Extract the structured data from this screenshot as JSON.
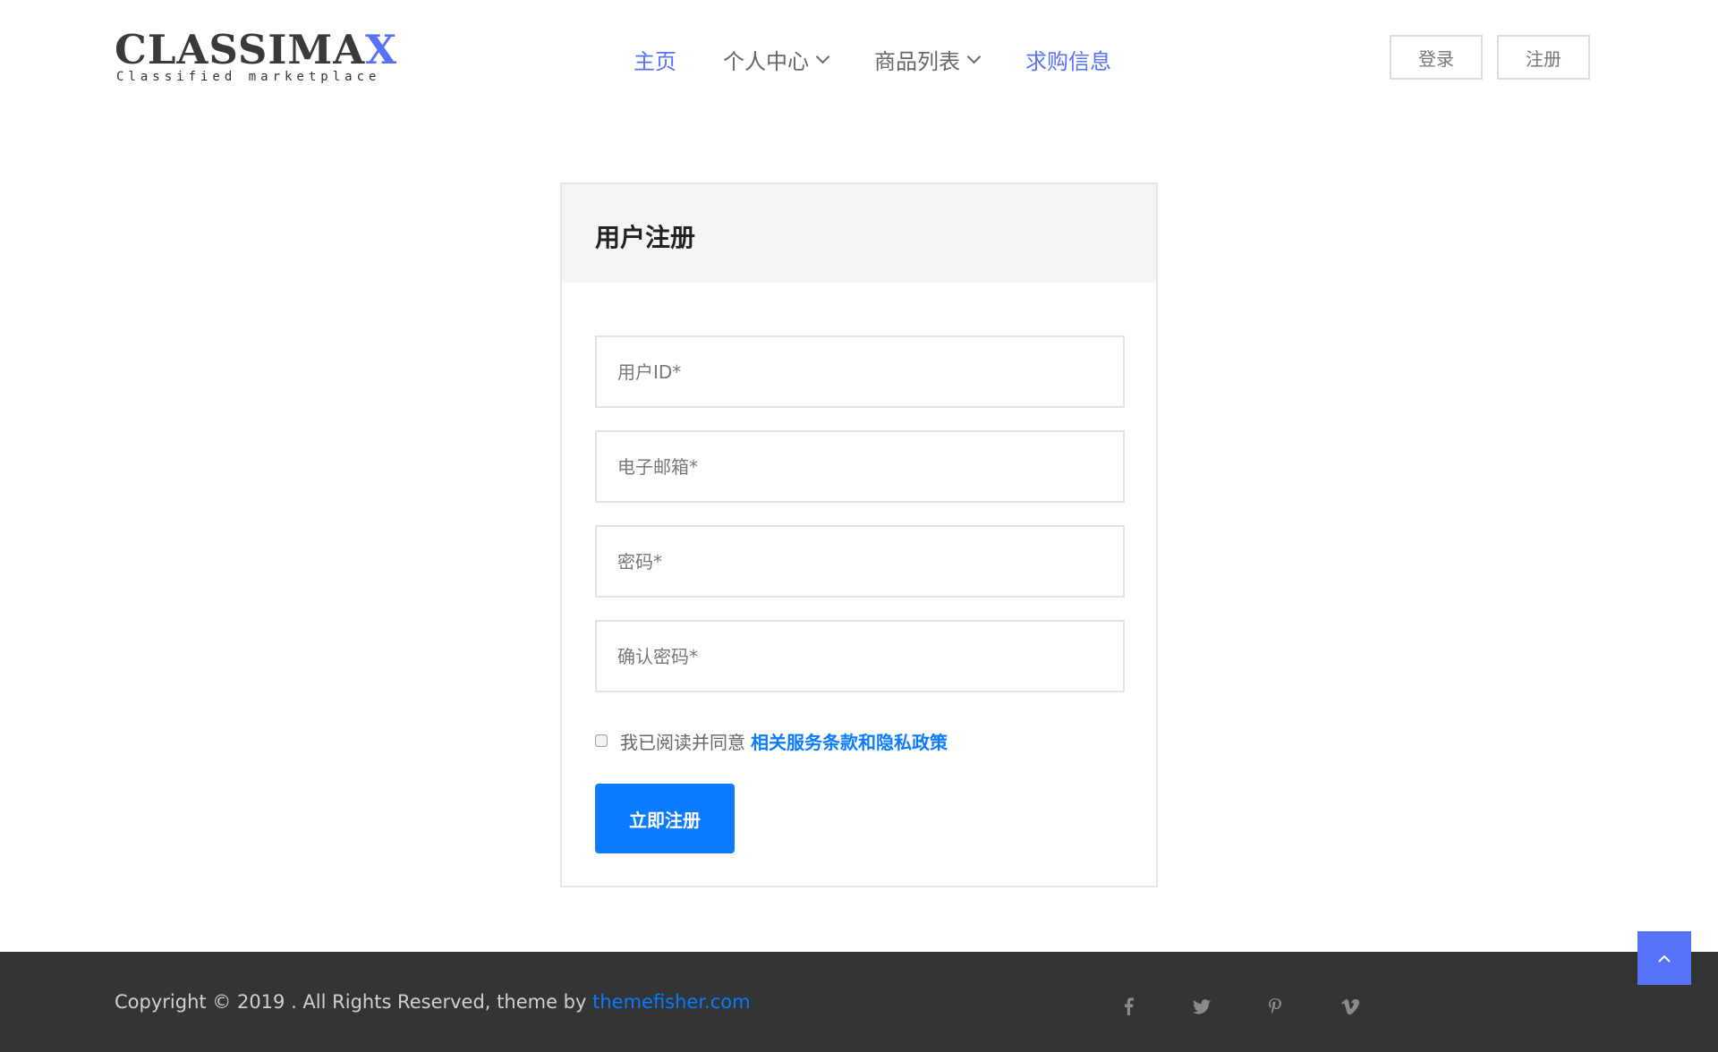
{
  "brand": {
    "name_main": "CLASSIMA",
    "name_accent": "X",
    "tagline": "Classified marketplace"
  },
  "nav": {
    "home": "主页",
    "personal_center": "个人中心",
    "product_list": "商品列表",
    "purchase_info": "求购信息"
  },
  "auth": {
    "login": "登录",
    "register": "注册"
  },
  "form": {
    "title": "用户注册",
    "user_id_placeholder": "用户ID*",
    "email_placeholder": "电子邮箱*",
    "password_placeholder": "密码*",
    "confirm_password_placeholder": "确认密码*",
    "agree_text": "我已阅读并同意",
    "agree_link": "相关服务条款和隐私政策",
    "submit_label": "立即注册"
  },
  "footer": {
    "copyright": "Copyright © 2019 . All Rights Reserved, theme by ",
    "theme_link": "themefisher.com",
    "social_icons": [
      "facebook-icon",
      "twitter-icon",
      "pinterest-icon",
      "vimeo-icon"
    ]
  },
  "colors": {
    "accent": "#5672f9",
    "primary_button": "#0b7bff",
    "footer_bg": "#333436"
  }
}
